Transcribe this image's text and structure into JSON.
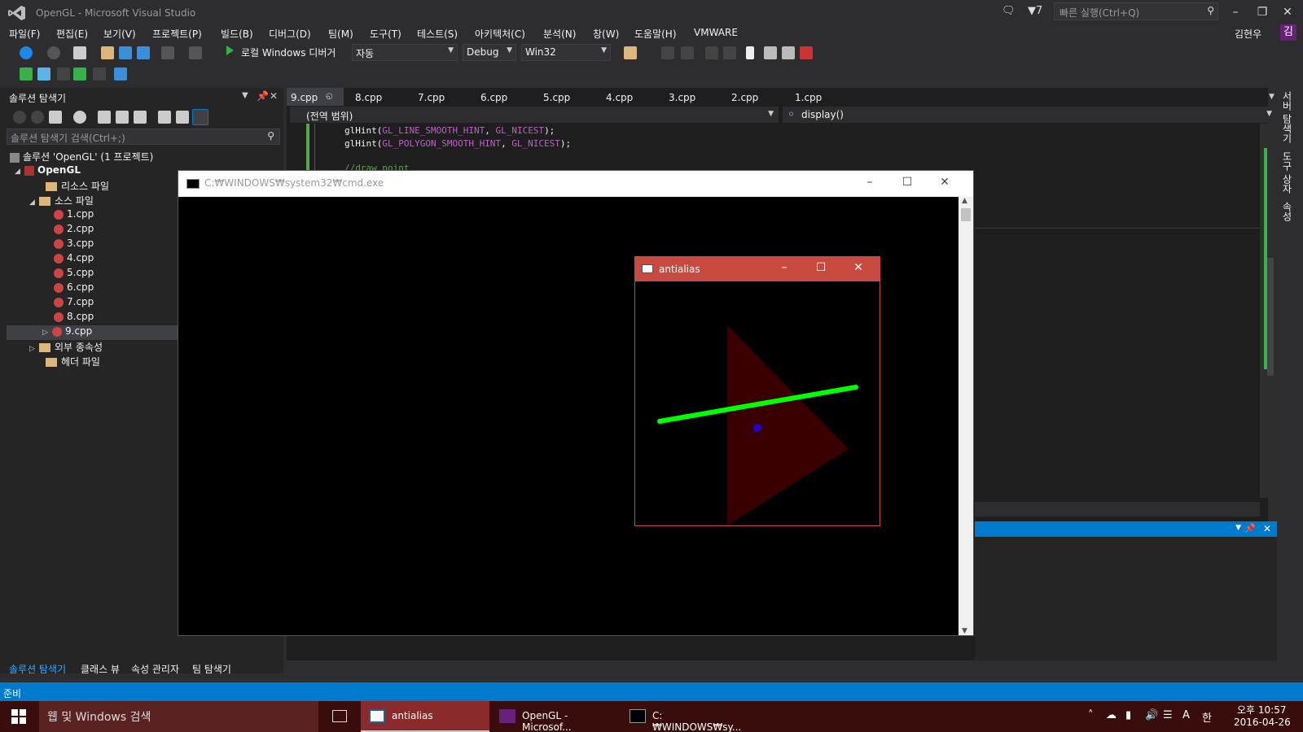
{
  "window": {
    "title": "OpenGL - Microsoft Visual Studio",
    "notifications_count": "7",
    "quick_launch_placeholder": "빠른 실행(Ctrl+Q)",
    "user_name": "김현우",
    "user_initial": "김"
  },
  "menu": [
    "파일(F)",
    "편집(E)",
    "보기(V)",
    "프로젝트(P)",
    "빌드(B)",
    "디버그(D)",
    "팀(M)",
    "도구(T)",
    "테스트(S)",
    "아키텍처(C)",
    "분석(N)",
    "창(W)",
    "도움말(H)",
    "VMWARE"
  ],
  "toolbar": {
    "start_debugger": "로컬 Windows 디버거",
    "solution_config_mode": "자동",
    "configuration": "Debug",
    "platform": "Win32"
  },
  "solution_explorer": {
    "title": "솔루션 탐색기",
    "search_placeholder": "솔루션 탐색기 검색(Ctrl+;)",
    "solution": "솔루션 'OpenGL' (1 프로젝트)",
    "project": "OpenGL",
    "folders": {
      "resources": "리소스 파일",
      "sources": "소스 파일",
      "external": "외부 종속성",
      "headers": "헤더 파일"
    },
    "files": [
      "1.cpp",
      "2.cpp",
      "3.cpp",
      "4.cpp",
      "5.cpp",
      "6.cpp",
      "7.cpp",
      "8.cpp",
      "9.cpp"
    ],
    "selected_file": "9.cpp",
    "bottom_tabs": [
      "솔루션 탐색기",
      "클래스 뷰",
      "속성 관리자",
      "팀 탐색기"
    ]
  },
  "editor": {
    "tabs": [
      "9.cpp",
      "8.cpp",
      "7.cpp",
      "6.cpp",
      "5.cpp",
      "4.cpp",
      "3.cpp",
      "2.cpp",
      "1.cpp"
    ],
    "active_tab": "9.cpp",
    "scope": "(전역 범위)",
    "member": "display()",
    "code": {
      "line1_fn": "glHint(",
      "line1_arg1": "GL_LINE_SMOOTH_HINT",
      "line1_sep": ", ",
      "line1_arg2": "GL_NICEST",
      "line1_end": ");",
      "line2_fn": "glHint(",
      "line2_arg1": "GL_POLYGON_SMOOTH_HINT",
      "line2_sep": ", ",
      "line2_arg2": "GL_NICEST",
      "line2_end": ");",
      "line3_comment": "//draw point"
    }
  },
  "right_strip": [
    "서버 탐색기",
    "도구 상자",
    "속성"
  ],
  "cmd_window": {
    "title": "C:₩WINDOWS₩system32₩cmd.exe"
  },
  "antialias_window": {
    "title": "antialias",
    "colors": {
      "triangle": "#3a0000",
      "line": "#00ff00",
      "point": "#2200cc"
    }
  },
  "status": "준비",
  "taskbar": {
    "search_placeholder": "웹 및 Windows 검색",
    "items": [
      "antialias",
      "OpenGL - Microsof...",
      "C:₩WINDOWS₩sy..."
    ],
    "time": "오후 10:57",
    "date": "2016-04-26",
    "ime": "A",
    "ime2": "한"
  }
}
